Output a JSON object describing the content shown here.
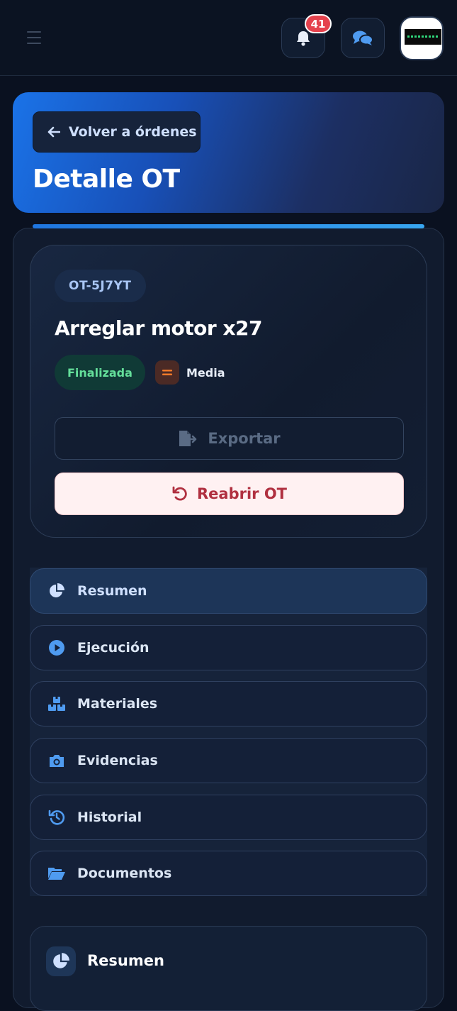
{
  "topbar": {
    "notifications_count": "41"
  },
  "hero": {
    "back_label": "Volver a órdenes",
    "title": "Detalle OT"
  },
  "order": {
    "code": "OT-5J7YT",
    "title": "Arreglar motor x27",
    "status": "Finalizada",
    "priority": "Media",
    "export_label": "Exportar",
    "reopen_label": "Reabrir OT"
  },
  "tabs": [
    {
      "label": "Resumen",
      "icon": "chart-pie-icon",
      "active": true
    },
    {
      "label": "Ejecución",
      "icon": "play-circle-icon",
      "active": false
    },
    {
      "label": "Materiales",
      "icon": "boxes-icon",
      "active": false
    },
    {
      "label": "Evidencias",
      "icon": "camera-icon",
      "active": false
    },
    {
      "label": "Historial",
      "icon": "history-icon",
      "active": false
    },
    {
      "label": "Documentos",
      "icon": "folder-open-icon",
      "active": false
    }
  ],
  "summary": {
    "title": "Resumen"
  },
  "colors": {
    "accent": "#1a73e8",
    "status_bg": "#103a36",
    "status_text": "#64df9a",
    "priority_icon": "#f07a2a",
    "danger": "#b03040"
  }
}
